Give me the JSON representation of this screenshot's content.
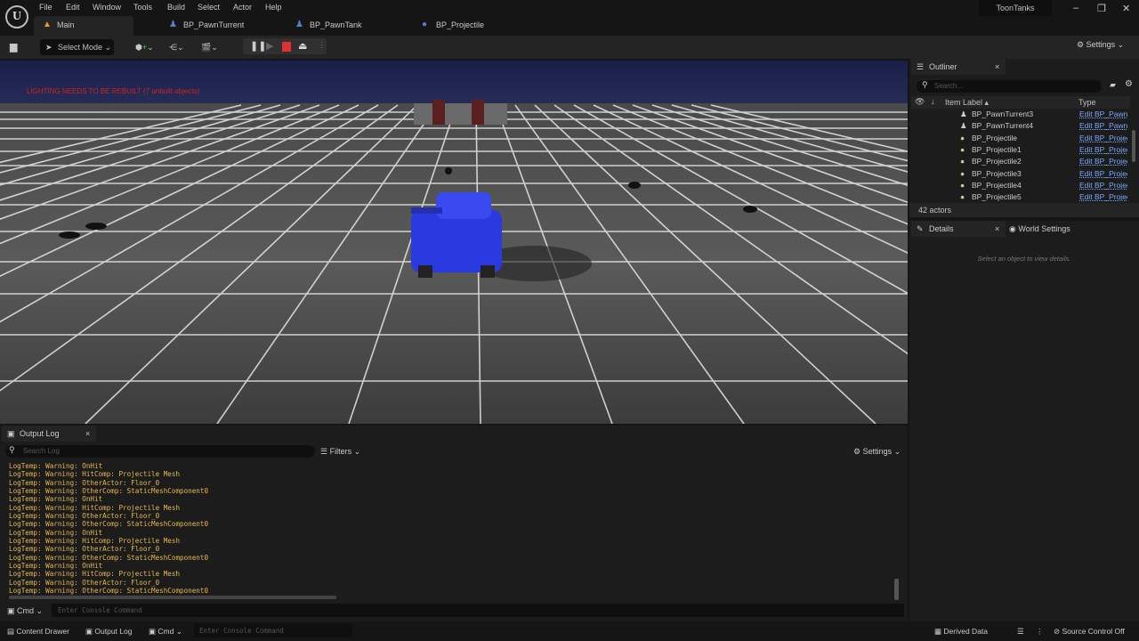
{
  "app": {
    "project": "ToonTanks",
    "logo": "UE"
  },
  "menu": [
    "File",
    "Edit",
    "Window",
    "Tools",
    "Build",
    "Select",
    "Actor",
    "Help"
  ],
  "tabs": [
    {
      "label": "Main",
      "icon": "level-icon"
    },
    {
      "label": "BP_PawnTurrent",
      "icon": "pawn-icon"
    },
    {
      "label": "BP_PawnTank",
      "icon": "pawn-icon"
    },
    {
      "label": "BP_Projectile",
      "icon": "actor-icon"
    }
  ],
  "toolbar": {
    "select_mode": "Select Mode",
    "settings": "Settings"
  },
  "viewport": {
    "warning": "LIGHTING NEEDS TO BE REBUILT (7 unbuilt objects)",
    "warning_color": "#d42020"
  },
  "outliner": {
    "title": "Outliner",
    "search_placeholder": "Search...",
    "col_label": "Item Label",
    "col_type": "Type",
    "rows": [
      {
        "label": "BP_PawnTurrent3",
        "type": "Edit BP_Pawn"
      },
      {
        "label": "BP_PawnTurrent4",
        "type": "Edit BP_Pawn"
      },
      {
        "label": "BP_Projectile",
        "type": "Edit BP_Projec"
      },
      {
        "label": "BP_Projectile1",
        "type": "Edit BP_Projec"
      },
      {
        "label": "BP_Projectile2",
        "type": "Edit BP_Projec"
      },
      {
        "label": "BP_Projectile3",
        "type": "Edit BP_Projec"
      },
      {
        "label": "BP_Projectile4",
        "type": "Edit BP_Projec"
      },
      {
        "label": "BP_Projectile5",
        "type": "Edit BP_Projec"
      }
    ],
    "count": "42 actors"
  },
  "details": {
    "title": "Details",
    "world_settings": "World Settings",
    "empty": "Select an object to view details."
  },
  "output_log": {
    "title": "Output Log",
    "search_placeholder": "Search Log",
    "filters": "Filters",
    "settings": "Settings",
    "lines": [
      "LogTemp: Warning: OnHit",
      "LogTemp: Warning: HitComp: Projectile Mesh",
      "LogTemp: Warning: OtherActor: Floor_0",
      "LogTemp: Warning: OtherComp: StaticMeshComponent0",
      "LogTemp: Warning: OnHit",
      "LogTemp: Warning: HitComp: Projectile Mesh",
      "LogTemp: Warning: OtherActor: Floor_0",
      "LogTemp: Warning: OtherComp: StaticMeshComponent0",
      "LogTemp: Warning: OnHit",
      "LogTemp: Warning: HitComp: Projectile Mesh",
      "LogTemp: Warning: OtherActor: Floor_0",
      "LogTemp: Warning: OtherComp: StaticMeshComponent0",
      "LogTemp: Warning: OnHit",
      "LogTemp: Warning: HitComp: Projectile Mesh",
      "LogTemp: Warning: OtherActor: Floor_0",
      "LogTemp: Warning: OtherComp: StaticMeshComponent0"
    ],
    "cmd": "Cmd",
    "cmd_placeholder": "Enter Console Command"
  },
  "statusbar": {
    "content_drawer": "Content Drawer",
    "output_log": "Output Log",
    "cmd": "Cmd",
    "cmd_placeholder": "Enter Console Command",
    "derived_data": "Derived Data",
    "source_control": "Source Control Off"
  }
}
